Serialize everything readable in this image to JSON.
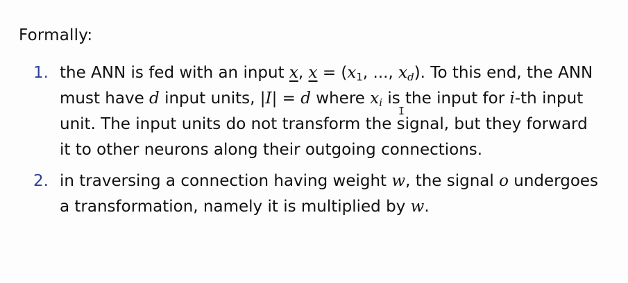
{
  "heading": "Formally:",
  "items": [
    {
      "number": "1.",
      "parts": {
        "a": "the ANN is fed with an input ",
        "x1": "x",
        "b": ", ",
        "x2": "x",
        "c": " = (",
        "x3": "x",
        "s1": "1",
        "d": ", ..., ",
        "x4": "x",
        "sd": "d",
        "e": "). To this end, the ANN must have ",
        "dvar": "d",
        "f": " input units, |",
        "ivar": "I",
        "g": "| = ",
        "dvar2": "d",
        "h": " where ",
        "xi": "x",
        "si": "i",
        "i": " is the input for ",
        "ivar2": "i",
        "j": "-th input unit. The input units do not transform the signal, but they forward it to other neurons along their outgoing connections."
      }
    },
    {
      "number": "2.",
      "parts": {
        "a": "in traversing a connection having weight ",
        "w": "w",
        "b": ", the signal ",
        "o": "o",
        "c": " undergoes a transformation, namely it is multiplied by ",
        "w2": "w",
        "d": "."
      }
    }
  ],
  "cursor": "I"
}
